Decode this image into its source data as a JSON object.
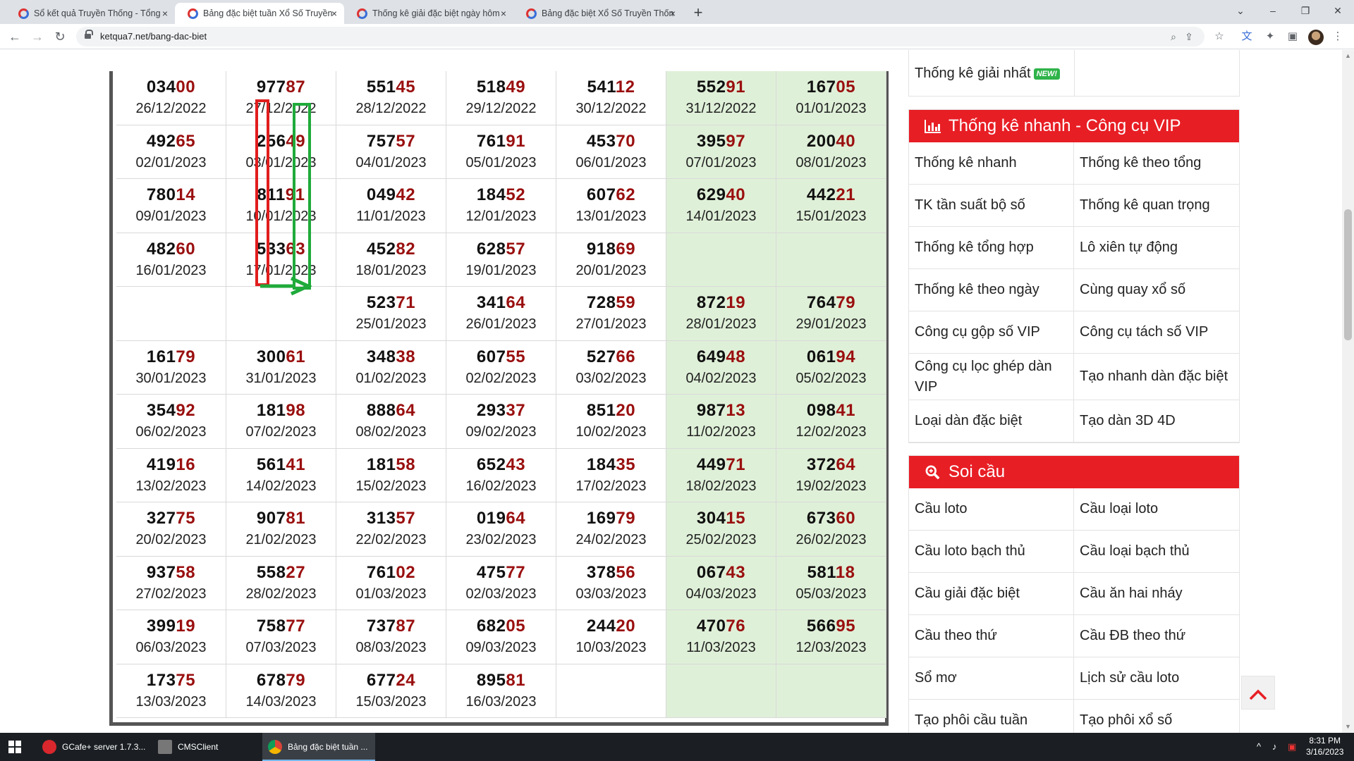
{
  "browser": {
    "tabs": [
      {
        "title": "Sổ kết quả Truyền Thống - Tổng"
      },
      {
        "title": "Bảng đặc biệt tuần Xổ Số Truyền"
      },
      {
        "title": "Thống kê giải đặc biệt ngày hôm"
      },
      {
        "title": "Bảng đặc biệt Xổ Số Truyền Thốn"
      }
    ],
    "url": "ketqua7.net/bang-dac-biet",
    "new_tab": "+",
    "tab_close": "×"
  },
  "results": {
    "rows": [
      [
        {
          "head": "034",
          "tail": "00",
          "date": "26/12/2022"
        },
        {
          "head": "977",
          "tail": "87",
          "date": "27/12/2022"
        },
        {
          "head": "551",
          "tail": "45",
          "date": "28/12/2022"
        },
        {
          "head": "518",
          "tail": "49",
          "date": "29/12/2022"
        },
        {
          "head": "541",
          "tail": "12",
          "date": "30/12/2022"
        },
        {
          "head": "552",
          "tail": "91",
          "date": "31/12/2022"
        },
        {
          "head": "167",
          "tail": "05",
          "date": "01/01/2023"
        }
      ],
      [
        {
          "head": "492",
          "tail": "65",
          "date": "02/01/2023"
        },
        {
          "head": "256",
          "tail": "49",
          "date": "03/01/2023"
        },
        {
          "head": "757",
          "tail": "57",
          "date": "04/01/2023"
        },
        {
          "head": "761",
          "tail": "91",
          "date": "05/01/2023"
        },
        {
          "head": "453",
          "tail": "70",
          "date": "06/01/2023"
        },
        {
          "head": "395",
          "tail": "97",
          "date": "07/01/2023"
        },
        {
          "head": "200",
          "tail": "40",
          "date": "08/01/2023"
        }
      ],
      [
        {
          "head": "780",
          "tail": "14",
          "date": "09/01/2023"
        },
        {
          "head": "811",
          "tail": "91",
          "date": "10/01/2023"
        },
        {
          "head": "049",
          "tail": "42",
          "date": "11/01/2023"
        },
        {
          "head": "184",
          "tail": "52",
          "date": "12/01/2023"
        },
        {
          "head": "607",
          "tail": "62",
          "date": "13/01/2023"
        },
        {
          "head": "629",
          "tail": "40",
          "date": "14/01/2023"
        },
        {
          "head": "442",
          "tail": "21",
          "date": "15/01/2023"
        }
      ],
      [
        {
          "head": "482",
          "tail": "60",
          "date": "16/01/2023"
        },
        {
          "head": "533",
          "tail": "63",
          "date": "17/01/2023"
        },
        {
          "head": "452",
          "tail": "82",
          "date": "18/01/2023"
        },
        {
          "head": "628",
          "tail": "57",
          "date": "19/01/2023"
        },
        {
          "head": "918",
          "tail": "69",
          "date": "20/01/2023"
        },
        {
          "head": "",
          "tail": "",
          "date": ""
        },
        {
          "head": "",
          "tail": "",
          "date": ""
        }
      ],
      [
        {
          "head": "",
          "tail": "",
          "date": ""
        },
        {
          "head": "",
          "tail": "",
          "date": ""
        },
        {
          "head": "523",
          "tail": "71",
          "date": "25/01/2023"
        },
        {
          "head": "341",
          "tail": "64",
          "date": "26/01/2023"
        },
        {
          "head": "728",
          "tail": "59",
          "date": "27/01/2023"
        },
        {
          "head": "872",
          "tail": "19",
          "date": "28/01/2023"
        },
        {
          "head": "764",
          "tail": "79",
          "date": "29/01/2023"
        }
      ],
      [
        {
          "head": "161",
          "tail": "79",
          "date": "30/01/2023"
        },
        {
          "head": "300",
          "tail": "61",
          "date": "31/01/2023"
        },
        {
          "head": "348",
          "tail": "38",
          "date": "01/02/2023"
        },
        {
          "head": "607",
          "tail": "55",
          "date": "02/02/2023"
        },
        {
          "head": "527",
          "tail": "66",
          "date": "03/02/2023"
        },
        {
          "head": "649",
          "tail": "48",
          "date": "04/02/2023"
        },
        {
          "head": "061",
          "tail": "94",
          "date": "05/02/2023"
        }
      ],
      [
        {
          "head": "354",
          "tail": "92",
          "date": "06/02/2023"
        },
        {
          "head": "181",
          "tail": "98",
          "date": "07/02/2023"
        },
        {
          "head": "888",
          "tail": "64",
          "date": "08/02/2023"
        },
        {
          "head": "293",
          "tail": "37",
          "date": "09/02/2023"
        },
        {
          "head": "851",
          "tail": "20",
          "date": "10/02/2023"
        },
        {
          "head": "987",
          "tail": "13",
          "date": "11/02/2023"
        },
        {
          "head": "098",
          "tail": "41",
          "date": "12/02/2023"
        }
      ],
      [
        {
          "head": "419",
          "tail": "16",
          "date": "13/02/2023"
        },
        {
          "head": "561",
          "tail": "41",
          "date": "14/02/2023"
        },
        {
          "head": "181",
          "tail": "58",
          "date": "15/02/2023"
        },
        {
          "head": "652",
          "tail": "43",
          "date": "16/02/2023"
        },
        {
          "head": "184",
          "tail": "35",
          "date": "17/02/2023"
        },
        {
          "head": "449",
          "tail": "71",
          "date": "18/02/2023"
        },
        {
          "head": "372",
          "tail": "64",
          "date": "19/02/2023"
        }
      ],
      [
        {
          "head": "327",
          "tail": "75",
          "date": "20/02/2023"
        },
        {
          "head": "907",
          "tail": "81",
          "date": "21/02/2023"
        },
        {
          "head": "313",
          "tail": "57",
          "date": "22/02/2023"
        },
        {
          "head": "019",
          "tail": "64",
          "date": "23/02/2023"
        },
        {
          "head": "169",
          "tail": "79",
          "date": "24/02/2023"
        },
        {
          "head": "304",
          "tail": "15",
          "date": "25/02/2023"
        },
        {
          "head": "673",
          "tail": "60",
          "date": "26/02/2023"
        }
      ],
      [
        {
          "head": "937",
          "tail": "58",
          "date": "27/02/2023"
        },
        {
          "head": "558",
          "tail": "27",
          "date": "28/02/2023"
        },
        {
          "head": "761",
          "tail": "02",
          "date": "01/03/2023"
        },
        {
          "head": "475",
          "tail": "77",
          "date": "02/03/2023"
        },
        {
          "head": "378",
          "tail": "56",
          "date": "03/03/2023"
        },
        {
          "head": "067",
          "tail": "43",
          "date": "04/03/2023"
        },
        {
          "head": "581",
          "tail": "18",
          "date": "05/03/2023"
        }
      ],
      [
        {
          "head": "399",
          "tail": "19",
          "date": "06/03/2023"
        },
        {
          "head": "758",
          "tail": "77",
          "date": "07/03/2023"
        },
        {
          "head": "737",
          "tail": "87",
          "date": "08/03/2023"
        },
        {
          "head": "682",
          "tail": "05",
          "date": "09/03/2023"
        },
        {
          "head": "244",
          "tail": "20",
          "date": "10/03/2023"
        },
        {
          "head": "470",
          "tail": "76",
          "date": "11/03/2023"
        },
        {
          "head": "566",
          "tail": "95",
          "date": "12/03/2023"
        }
      ],
      [
        {
          "head": "173",
          "tail": "75",
          "date": "13/03/2023"
        },
        {
          "head": "678",
          "tail": "79",
          "date": "14/03/2023"
        },
        {
          "head": "677",
          "tail": "24",
          "date": "15/03/2023"
        },
        {
          "head": "895",
          "tail": "81",
          "date": "16/03/2023"
        },
        {
          "head": "",
          "tail": "",
          "date": ""
        },
        {
          "head": "",
          "tail": "",
          "date": ""
        },
        {
          "head": "",
          "tail": "",
          "date": ""
        }
      ]
    ]
  },
  "sidebar": {
    "top_item": "Thống kê giải nhất",
    "top_badge": "NEW!",
    "panels": [
      {
        "title": "Thống kê nhanh - Công cụ VIP",
        "icon": "bar-chart-icon",
        "items": [
          "Thống kê nhanh",
          "Thống kê theo tổng",
          "TK tần suất bộ số",
          "Thống kê quan trọng",
          "Thống kê tổng hợp",
          "Lô xiên tự động",
          "Thống kê theo ngày",
          "Cùng quay xổ số",
          "Công cụ gộp số VIP",
          "Công cụ tách số VIP",
          "Công cụ lọc ghép dàn VIP",
          "Tạo nhanh dàn đặc biệt",
          "Loại dàn đặc biệt",
          "Tạo dàn 3D 4D"
        ]
      },
      {
        "title": "Soi cầu",
        "icon": "search-icon",
        "items": [
          "Cầu loto",
          "Cầu loại loto",
          "Cầu loto bạch thủ",
          "Cầu loại bạch thủ",
          "Cầu giải đặc biệt",
          "Cầu ăn hai nháy",
          "Cầu theo thứ",
          "Cầu ĐB theo thứ",
          "Sổ mơ",
          "Lịch sử cầu loto",
          "Tạo phôi cầu tuần",
          "Tạo phôi xổ số"
        ]
      }
    ],
    "back_to_top": "^"
  },
  "colors": {
    "accent_red": "#e81e25",
    "number_tail": "#9a0f0f",
    "weekend_bg": "#dff0d8",
    "mark_red": "#e11d1d",
    "mark_green": "#1faa3a"
  },
  "taskbar": {
    "items": [
      {
        "label": "GCafe+ server 1.7.3..."
      },
      {
        "label": "CMSClient"
      },
      {
        "label": "Bảng đặc biệt tuần ..."
      }
    ],
    "time": "8:31 PM",
    "date": "3/16/2023"
  }
}
